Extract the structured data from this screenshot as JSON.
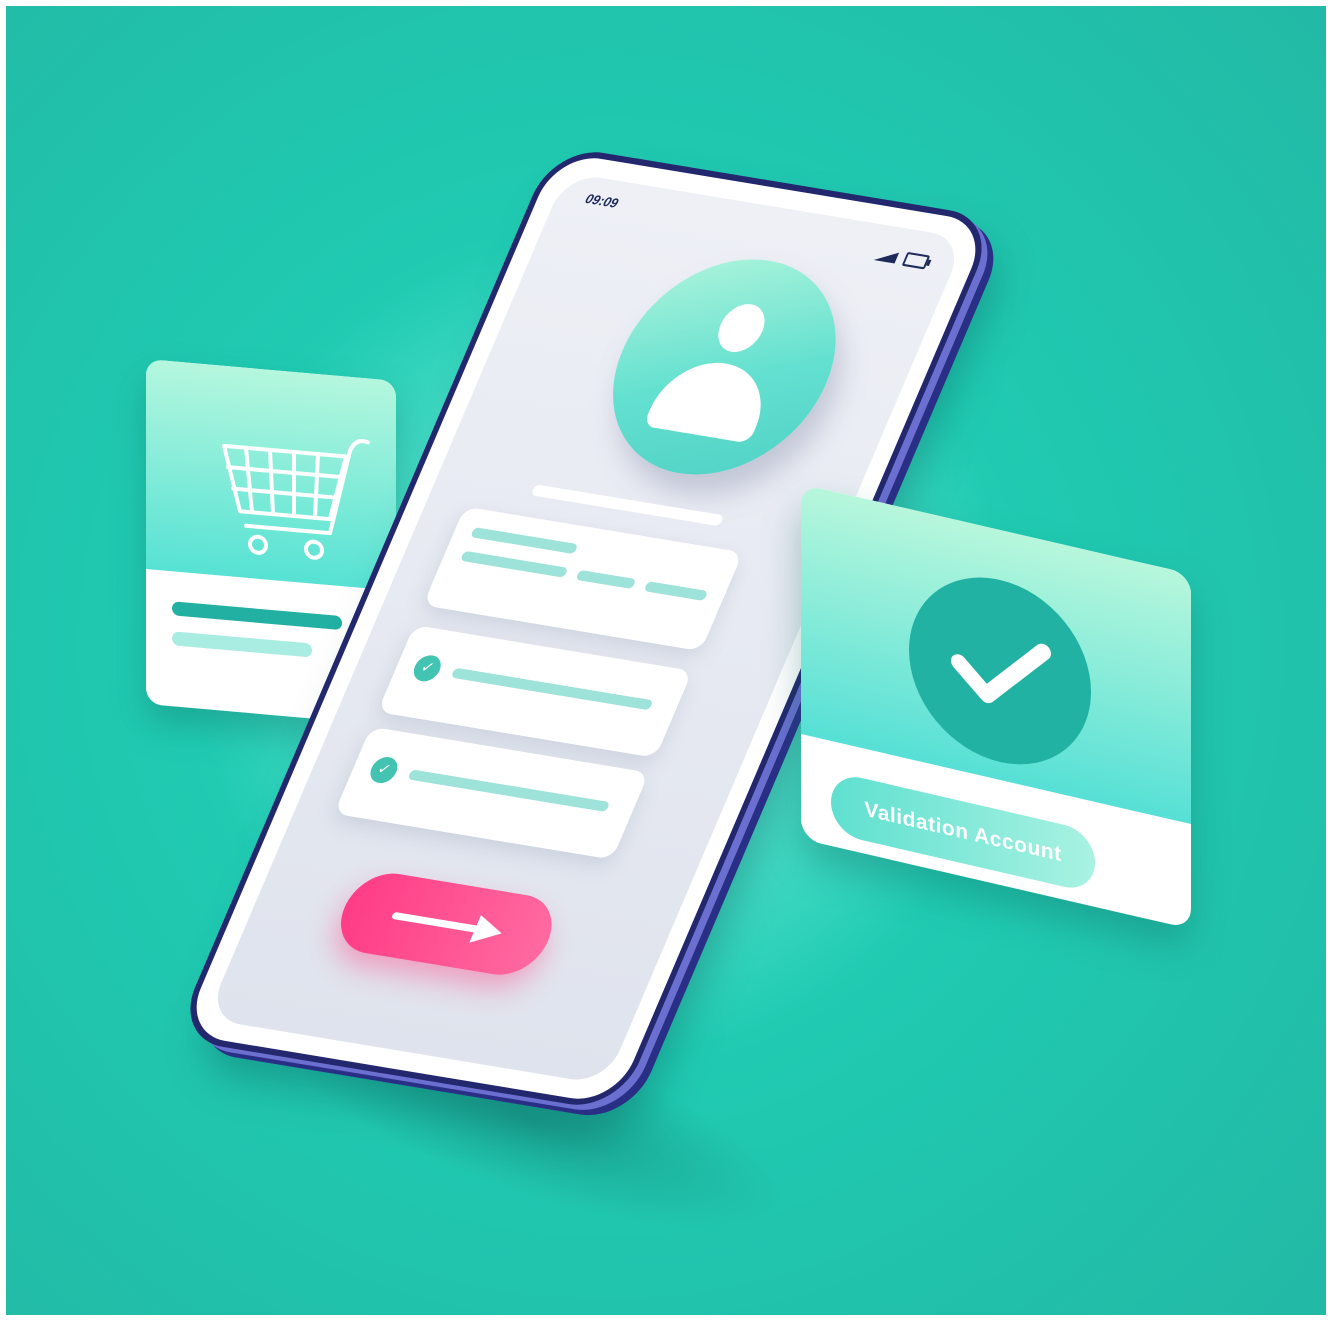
{
  "phone": {
    "status_time": "09:09",
    "icons": [
      "signal-icon",
      "battery-icon",
      "user-avatar-icon",
      "check-icon",
      "arrow-right-icon"
    ]
  },
  "cart_card": {
    "icon": "shopping-cart-icon"
  },
  "validation_card": {
    "icon": "check-icon",
    "button_label": "Validation Account"
  },
  "colors": {
    "background": "#20cbb2",
    "accent_teal": "#21b2a4",
    "mint": "#b5f7de",
    "button_pink": "#ff3c86",
    "phone_frame": "#22276e"
  }
}
